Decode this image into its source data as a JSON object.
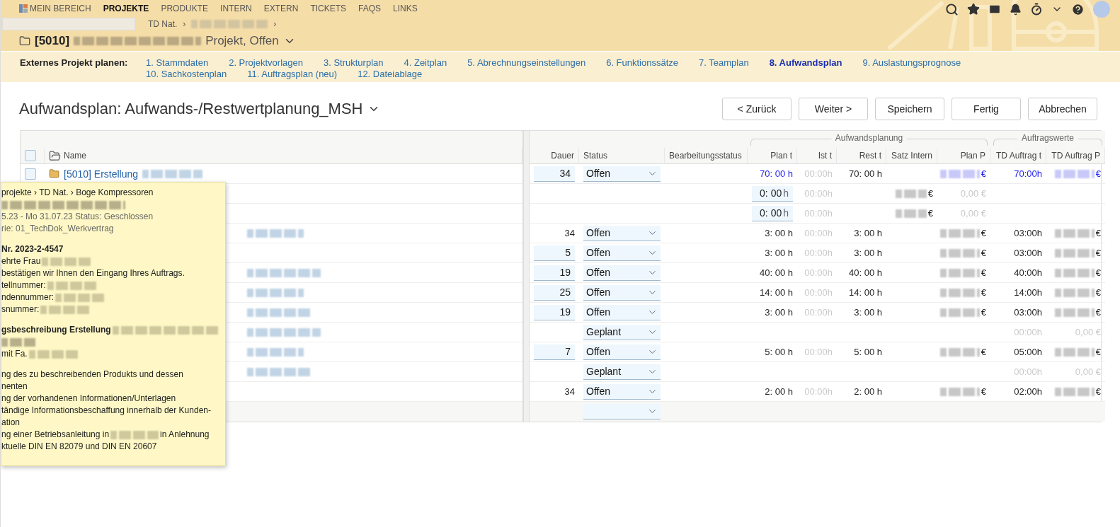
{
  "nav": {
    "items": [
      {
        "label": "MEIN BEREICH",
        "kind": "home",
        "selected": false
      },
      {
        "label": "PROJEKTE",
        "kind": "plain",
        "selected": true
      },
      {
        "label": "PRODUKTE",
        "kind": "plain",
        "selected": false
      },
      {
        "label": "INTERN",
        "kind": "plain",
        "selected": false
      },
      {
        "label": "EXTERN",
        "kind": "plain",
        "selected": false
      },
      {
        "label": "TICKETS",
        "kind": "plain",
        "selected": false
      },
      {
        "label": "FAQS",
        "kind": "plain",
        "selected": false
      },
      {
        "label": "LINKS",
        "kind": "plain",
        "selected": false
      }
    ]
  },
  "breadcrumb": {
    "items": [
      "TD Nat.",
      "›",
      "›"
    ]
  },
  "project": {
    "number": "[5010]",
    "status": "Projekt, Offen"
  },
  "steps": {
    "label": "Externes Projekt planen:",
    "items": [
      {
        "label": "1. Stammdaten",
        "selected": false
      },
      {
        "label": "2. Projektvorlagen",
        "selected": false
      },
      {
        "label": "3. Strukturplan",
        "selected": false
      },
      {
        "label": "4. Zeitplan",
        "selected": false
      },
      {
        "label": "5. Abrechnungseinstellungen",
        "selected": false
      },
      {
        "label": "6. Funktionssätze",
        "selected": false
      },
      {
        "label": "7. Teamplan",
        "selected": false
      },
      {
        "label": "8. Aufwandsplan",
        "selected": true
      },
      {
        "label": "9. Auslastungsprognose",
        "selected": false
      },
      {
        "label": "10. Sachkostenplan",
        "selected": false
      },
      {
        "label": "11. Auftragsplan (neu)",
        "selected": false
      },
      {
        "label": "12. Dateiablage",
        "selected": false
      }
    ]
  },
  "page_title": "Aufwandsplan: Aufwands-/Restwertplanung_MSH",
  "buttons": [
    "< Zurück",
    "Weiter >",
    "Speichern",
    "Fertig",
    "Abbrechen"
  ],
  "table": {
    "header_checkbox": {
      "checked": false
    },
    "name_column": "Name",
    "groups": [
      "Aufwandsplanung",
      "Auftragswerte"
    ],
    "columns": [
      "Dauer",
      "Status",
      "Bearbeitungsstatus",
      "Plan t",
      "Ist t",
      "Rest t",
      "Satz Intern",
      "Plan P",
      "TD Auftrag t",
      "TD Auftrag P"
    ],
    "rows": [
      {
        "checkbox": {
          "checked": false
        },
        "name": "[5010] Erstellung",
        "name_blurred": true,
        "cells": [
          {
            "kind": "input",
            "text": "34"
          },
          {
            "kind": "select",
            "text": "Offen"
          },
          null,
          {
            "kind": "text",
            "text": "70: 00 h",
            "highlighted": true,
            "muted": false
          },
          {
            "kind": "text",
            "text": "00:00h",
            "highlighted": false,
            "muted": true
          },
          {
            "kind": "text",
            "text": "70: 00 h",
            "highlighted": false,
            "muted": false
          },
          null,
          {
            "kind": "amount",
            "text": "€",
            "highlighted": true
          },
          {
            "kind": "text",
            "text": "70:00h",
            "highlighted": true,
            "muted": false
          },
          {
            "kind": "amount",
            "text": "€",
            "highlighted": true
          }
        ]
      },
      {
        "name_blurred": false,
        "cells": [
          null,
          null,
          null,
          {
            "kind": "input",
            "text": "0: 00",
            "unit": "h"
          },
          {
            "kind": "text",
            "text": "00:00h",
            "highlighted": false,
            "muted": true
          },
          null,
          {
            "kind": "amount",
            "text": "€",
            "highlighted": false
          },
          {
            "kind": "text",
            "text": "0,00 €",
            "highlighted": false,
            "muted": true
          },
          null,
          null
        ]
      },
      {
        "name_blurred": false,
        "cells": [
          null,
          null,
          null,
          {
            "kind": "input",
            "text": "0: 00",
            "unit": "h"
          },
          {
            "kind": "text",
            "text": "00:00h",
            "highlighted": false,
            "muted": true
          },
          null,
          {
            "kind": "amount",
            "text": "€",
            "highlighted": false
          },
          {
            "kind": "text",
            "text": "0,00 €",
            "highlighted": false,
            "muted": true
          },
          null,
          null
        ]
      },
      {
        "name_blurred": true,
        "cells": [
          {
            "kind": "text",
            "text": "34",
            "highlighted": false,
            "muted": false
          },
          {
            "kind": "select",
            "text": "Offen"
          },
          null,
          {
            "kind": "text",
            "text": "3: 00 h",
            "highlighted": false,
            "muted": false
          },
          {
            "kind": "text",
            "text": "00:00h",
            "highlighted": false,
            "muted": true
          },
          {
            "kind": "text",
            "text": "3: 00 h",
            "highlighted": false,
            "muted": false
          },
          null,
          {
            "kind": "amount",
            "text": "€",
            "highlighted": false
          },
          {
            "kind": "text",
            "text": "03:00h",
            "highlighted": false,
            "muted": false
          },
          {
            "kind": "amount",
            "text": "€",
            "highlighted": false
          }
        ]
      },
      {
        "name_blurred": false,
        "cells": [
          {
            "kind": "input",
            "text": "5"
          },
          {
            "kind": "select",
            "text": "Offen"
          },
          null,
          {
            "kind": "text",
            "text": "3: 00 h",
            "highlighted": false,
            "muted": false
          },
          {
            "kind": "text",
            "text": "00:00h",
            "highlighted": false,
            "muted": true
          },
          {
            "kind": "text",
            "text": "3: 00 h",
            "highlighted": false,
            "muted": false
          },
          null,
          {
            "kind": "amount",
            "text": "€",
            "highlighted": false
          },
          {
            "kind": "text",
            "text": "03:00h",
            "highlighted": false,
            "muted": false
          },
          {
            "kind": "amount",
            "text": "€",
            "highlighted": false
          }
        ]
      },
      {
        "name_blurred": true,
        "cells": [
          {
            "kind": "input",
            "text": "19"
          },
          {
            "kind": "select",
            "text": "Offen"
          },
          null,
          {
            "kind": "text",
            "text": "40: 00 h",
            "highlighted": false,
            "muted": false
          },
          {
            "kind": "text",
            "text": "00:00h",
            "highlighted": false,
            "muted": true
          },
          {
            "kind": "text",
            "text": "40: 00 h",
            "highlighted": false,
            "muted": false
          },
          null,
          {
            "kind": "amount",
            "text": "€",
            "highlighted": false
          },
          {
            "kind": "text",
            "text": "40:00h",
            "highlighted": false,
            "muted": false
          },
          {
            "kind": "amount",
            "text": "€",
            "highlighted": false
          }
        ]
      },
      {
        "name_blurred": true,
        "cells": [
          {
            "kind": "input",
            "text": "25"
          },
          {
            "kind": "select",
            "text": "Offen"
          },
          null,
          {
            "kind": "text",
            "text": "14: 00 h",
            "highlighted": false,
            "muted": false
          },
          {
            "kind": "text",
            "text": "00:00h",
            "highlighted": false,
            "muted": true
          },
          {
            "kind": "text",
            "text": "14: 00 h",
            "highlighted": false,
            "muted": false
          },
          null,
          {
            "kind": "amount",
            "text": "€",
            "highlighted": false
          },
          {
            "kind": "text",
            "text": "14:00h",
            "highlighted": false,
            "muted": false
          },
          {
            "kind": "amount",
            "text": "€",
            "highlighted": false
          }
        ]
      },
      {
        "name_blurred": true,
        "cells": [
          {
            "kind": "input",
            "text": "19"
          },
          {
            "kind": "select",
            "text": "Offen"
          },
          null,
          {
            "kind": "text",
            "text": "3: 00 h",
            "highlighted": false,
            "muted": false
          },
          {
            "kind": "text",
            "text": "00:00h",
            "highlighted": false,
            "muted": true
          },
          {
            "kind": "text",
            "text": "3: 00 h",
            "highlighted": false,
            "muted": false
          },
          null,
          {
            "kind": "amount",
            "text": "€",
            "highlighted": false
          },
          {
            "kind": "text",
            "text": "03:00h",
            "highlighted": false,
            "muted": false
          },
          {
            "kind": "amount",
            "text": "€",
            "highlighted": false
          }
        ]
      },
      {
        "name_blurred": true,
        "cells": [
          null,
          {
            "kind": "select",
            "text": "Geplant"
          },
          null,
          null,
          null,
          null,
          null,
          null,
          {
            "kind": "text",
            "text": "00:00h",
            "highlighted": false,
            "muted": true
          },
          {
            "kind": "text",
            "text": "0,00 €",
            "highlighted": false,
            "muted": true
          }
        ]
      },
      {
        "name_blurred": true,
        "cells": [
          {
            "kind": "input",
            "text": "7"
          },
          {
            "kind": "select",
            "text": "Offen"
          },
          null,
          {
            "kind": "text",
            "text": "5: 00 h",
            "highlighted": false,
            "muted": false
          },
          {
            "kind": "text",
            "text": "00:00h",
            "highlighted": false,
            "muted": true
          },
          {
            "kind": "text",
            "text": "5: 00 h",
            "highlighted": false,
            "muted": false
          },
          null,
          {
            "kind": "amount",
            "text": "€",
            "highlighted": false
          },
          {
            "kind": "text",
            "text": "05:00h",
            "highlighted": false,
            "muted": false
          },
          {
            "kind": "amount",
            "text": "€",
            "highlighted": false
          }
        ]
      },
      {
        "name_blurred": true,
        "cells": [
          null,
          {
            "kind": "select",
            "text": "Geplant"
          },
          null,
          null,
          null,
          null,
          null,
          null,
          {
            "kind": "text",
            "text": "00:00h",
            "highlighted": false,
            "muted": true
          },
          {
            "kind": "text",
            "text": "0,00 €",
            "highlighted": false,
            "muted": true
          }
        ]
      },
      {
        "name_blurred": false,
        "cells": [
          {
            "kind": "text",
            "text": "34",
            "highlighted": false,
            "muted": false
          },
          {
            "kind": "select",
            "text": "Offen"
          },
          null,
          {
            "kind": "text",
            "text": "2: 00 h",
            "highlighted": false,
            "muted": false
          },
          {
            "kind": "text",
            "text": "00:00h",
            "highlighted": false,
            "muted": true
          },
          {
            "kind": "text",
            "text": "2: 00 h",
            "highlighted": false,
            "muted": false
          },
          null,
          {
            "kind": "amount",
            "text": "€",
            "highlighted": false
          },
          {
            "kind": "text",
            "text": "02:00h",
            "highlighted": false,
            "muted": false
          },
          {
            "kind": "amount",
            "text": "€",
            "highlighted": false
          }
        ]
      }
    ]
  },
  "tooltip": {
    "lines": [
      {
        "kind": "line",
        "text": "projekte › TD Nat. › Boge Kompressoren",
        "bold": false,
        "muted": false,
        "blurred": false
      },
      {
        "kind": "blur"
      },
      {
        "kind": "line",
        "text": "5.23 - Mo 31.07.23   Status: Geschlossen",
        "bold": false,
        "muted": true,
        "blurred": false
      },
      {
        "kind": "line",
        "text": "rie: 01_TechDok_Werkvertrag",
        "bold": false,
        "muted": true,
        "blurred": false
      },
      {
        "kind": "gap"
      },
      {
        "kind": "line",
        "text": "Nr. 2023-2-4547",
        "bold": true,
        "muted": false,
        "blurred": false
      },
      {
        "kind": "line",
        "text": "ehrte Frau",
        "bold": false,
        "muted": false,
        "blurred": true
      },
      {
        "kind": "line",
        "text": "bestätigen wir Ihnen den Eingang Ihres Auftrags.",
        "bold": false,
        "muted": false,
        "blurred": false
      },
      {
        "kind": "line",
        "text": "tellnummer:",
        "bold": false,
        "muted": false,
        "blurred": true
      },
      {
        "kind": "line",
        "text": "ndennummer:",
        "bold": false,
        "muted": false,
        "blurred": true
      },
      {
        "kind": "line",
        "text": "snummer:",
        "bold": false,
        "muted": false,
        "blurred": true
      },
      {
        "kind": "gap"
      },
      {
        "kind": "line",
        "text": "gsbeschreibung Erstellung",
        "bold": true,
        "muted": false,
        "blurred": true
      },
      {
        "kind": "blur"
      },
      {
        "kind": "line",
        "text": "mit Fa.",
        "bold": false,
        "muted": false,
        "blurred": true
      },
      {
        "kind": "gap"
      },
      {
        "kind": "line",
        "text": "ng des zu beschreibenden Produkts und dessen",
        "bold": false,
        "muted": false,
        "blurred": false
      },
      {
        "kind": "line",
        "text": "nenten",
        "bold": false,
        "muted": false,
        "blurred": false
      },
      {
        "kind": "line",
        "text": "ng der vorhandenen Informationen/Unterlagen",
        "bold": false,
        "muted": false,
        "blurred": false
      },
      {
        "kind": "line",
        "text": "tändige Informationsbeschaffung innerhalb der Kunden-",
        "bold": false,
        "muted": false,
        "blurred": false
      },
      {
        "kind": "line",
        "text": "ation",
        "bold": false,
        "muted": false,
        "blurred": false
      },
      {
        "kind": "split",
        "text": "ng einer Betriebsanleitung in",
        "after": "in Anlehnung"
      },
      {
        "kind": "line",
        "text": "ktuelle DIN EN 82079 und DIN EN 20607",
        "bold": false,
        "muted": false,
        "blurred": false
      }
    ]
  }
}
